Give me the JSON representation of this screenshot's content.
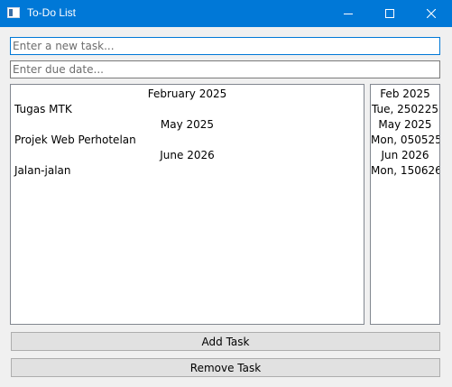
{
  "window": {
    "title": "To-Do List"
  },
  "inputs": {
    "task_placeholder": "Enter a new task...",
    "task_value": "",
    "due_placeholder": "Enter due date...",
    "due_value": ""
  },
  "task_list": {
    "rows": [
      {
        "kind": "header",
        "text": "February 2025"
      },
      {
        "kind": "task",
        "text": "Tugas MTK"
      },
      {
        "kind": "header",
        "text": "May 2025"
      },
      {
        "kind": "task",
        "text": "Projek Web Perhotelan"
      },
      {
        "kind": "header",
        "text": "June 2026"
      },
      {
        "kind": "task",
        "text": "Jalan-jalan"
      }
    ]
  },
  "date_list": {
    "rows": [
      "Feb 2025",
      "Tue, 250225",
      "May 2025",
      "Mon, 050525",
      "Jun 2026",
      "Mon, 150626"
    ]
  },
  "buttons": {
    "add_label": "Add Task",
    "remove_label": "Remove Task"
  },
  "colors": {
    "titlebar": "#0078d7",
    "window_bg": "#f0f0f0",
    "focus_border": "#0078d7"
  },
  "icons": {
    "app": "app-window-icon",
    "minimize": "minimize-icon",
    "maximize": "maximize-icon",
    "close": "close-icon"
  }
}
